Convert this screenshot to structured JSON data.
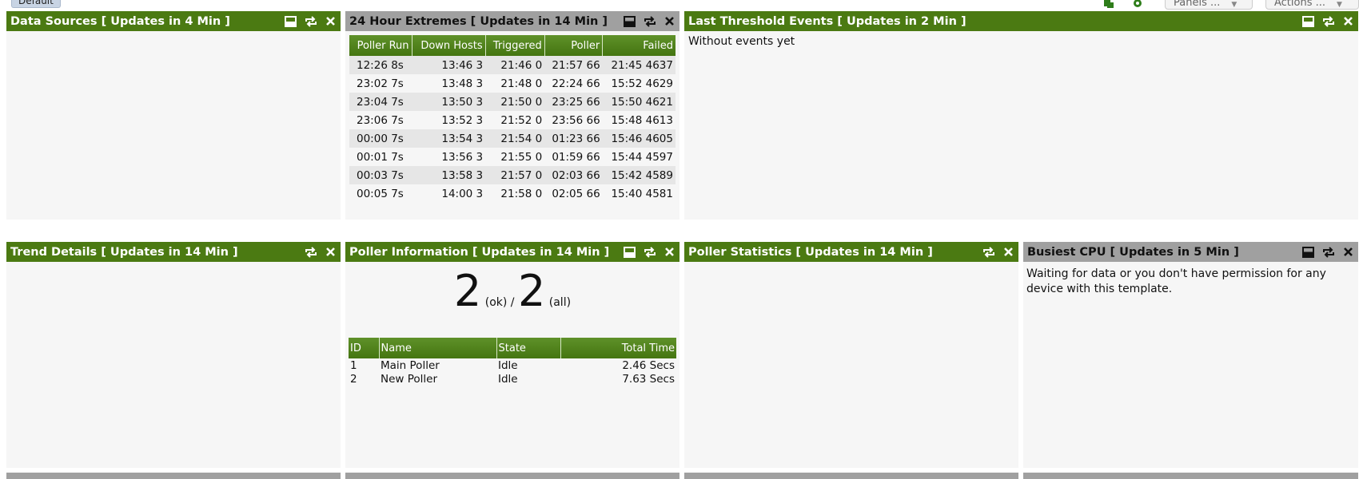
{
  "top": {
    "tab_label": "Default",
    "panels_select": "Panels ...",
    "actions_select": "Actions ...",
    "icons": [
      "copy-icon",
      "gear-icon"
    ]
  },
  "colors": {
    "header_green": "#4b7a12",
    "header_gray": "#a0a0a0",
    "panel_bg": "#f6f6f6"
  },
  "data_sources": {
    "title": "Data Sources [ Updates in 4 Min ]"
  },
  "extremes": {
    "title": "24 Hour Extremes [ Updates in 14 Min ]",
    "columns": [
      "Poller Run",
      "Down Hosts",
      "Triggered",
      "Poller",
      "Failed"
    ],
    "rows": [
      [
        "12:26 8s",
        "13:46 3",
        "21:46 0",
        "21:57 66",
        "21:45 4637"
      ],
      [
        "23:02 7s",
        "13:48 3",
        "21:48 0",
        "22:24 66",
        "15:52 4629"
      ],
      [
        "23:04 7s",
        "13:50 3",
        "21:50 0",
        "23:25 66",
        "15:50 4621"
      ],
      [
        "23:06 7s",
        "13:52 3",
        "21:52 0",
        "23:56 66",
        "15:48 4613"
      ],
      [
        "00:00 7s",
        "13:54 3",
        "21:54 0",
        "01:23 66",
        "15:46 4605"
      ],
      [
        "00:01 7s",
        "13:56 3",
        "21:55 0",
        "01:59 66",
        "15:44 4597"
      ],
      [
        "00:03 7s",
        "13:58 3",
        "21:57 0",
        "02:03 66",
        "15:42 4589"
      ],
      [
        "00:05 7s",
        "14:00 3",
        "21:58 0",
        "02:05 66",
        "15:40 4581"
      ]
    ]
  },
  "threshold": {
    "title": "Last Threshold Events [ Updates in 2 Min ]",
    "message": "Without events yet"
  },
  "trend": {
    "title": "Trend Details [ Updates in 14 Min ]"
  },
  "poller_info": {
    "title": "Poller Information [ Updates in 14 Min ]",
    "ok_count": "2",
    "ok_label": "(ok) /",
    "all_count": "2",
    "all_label": "(all)",
    "columns": [
      "ID",
      "Name",
      "State",
      "Total Time"
    ],
    "rows": [
      [
        "1",
        "Main Poller",
        "Idle",
        "2.46 Secs"
      ],
      [
        "2",
        "New Poller",
        "Idle",
        "7.63 Secs"
      ]
    ]
  },
  "poller_stats": {
    "title": "Poller Statistics [ Updates in 14 Min ]"
  },
  "busiest_cpu": {
    "title": "Busiest CPU [ Updates in 5 Min ]",
    "message": "Waiting for data or you don't have permission for any device with this template."
  }
}
